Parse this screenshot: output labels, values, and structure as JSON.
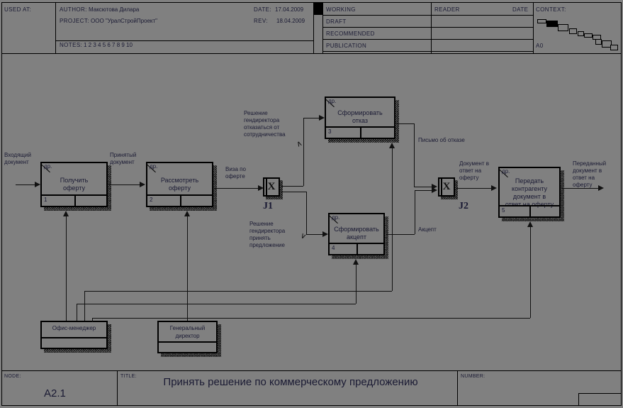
{
  "header": {
    "used_at_label": "USED AT:",
    "author_label": "AUTHOR:",
    "author_value": "Максютова Дилара",
    "project_label": "PROJECT:",
    "project_value": "ООО \"УралСтройПроект\"",
    "notes_label": "NOTES:",
    "notes_numbers": "1  2  3  4  5  6  7  8  9  10",
    "date_label": "DATE:",
    "date_value": "17.04.2009",
    "rev_label": "REV:",
    "rev_value": "18.04.2009",
    "status_rows": [
      "WORKING",
      "DRAFT",
      "RECOMMENDED",
      "PUBLICATION"
    ],
    "reader_label": "READER",
    "date_col_label": "DATE",
    "context_label": "CONTEXT:",
    "context_node": "A0"
  },
  "diagram": {
    "activities": [
      {
        "id": "a1",
        "corner": "др.",
        "title": "Получить\nоферту",
        "number": "1"
      },
      {
        "id": "a2",
        "corner": "др.",
        "title": "Рассмотреть\nоферту",
        "number": "2"
      },
      {
        "id": "a3",
        "corner": "др.",
        "title": "Сформировать\nотказ",
        "number": "3"
      },
      {
        "id": "a4",
        "corner": "др.",
        "title": "Сформировать\nакцепт",
        "number": "4"
      },
      {
        "id": "a5",
        "corner": "др.",
        "title": "Передать\nконтрагенту\nдокумент в\nответ на оферту",
        "number": "5"
      }
    ],
    "mechanisms": [
      {
        "id": "m1",
        "title": "Офис-менеджер"
      },
      {
        "id": "m2",
        "title": "Генеральный\nдиректор"
      }
    ],
    "junctions": [
      {
        "id": "j1",
        "glyph": "X",
        "label": "J1"
      },
      {
        "id": "j2",
        "glyph": "X",
        "label": "J2"
      }
    ],
    "flows": [
      {
        "id": "f_in",
        "text": "Входящий\nдокумент"
      },
      {
        "id": "f_accepted",
        "text": "Принятый\nдокумент"
      },
      {
        "id": "f_visa",
        "text": "Виза по\nоферте"
      },
      {
        "id": "f_refuse",
        "text": "Решение\nгендиректора\nотказаться от\nсотрудничества"
      },
      {
        "id": "f_accept",
        "text": "Решение\nгендиректора\nпринять\nпредложение"
      },
      {
        "id": "f_letter",
        "text": "Письмо об отказе"
      },
      {
        "id": "f_akcept",
        "text": "Акцепт"
      },
      {
        "id": "f_docreply",
        "text": "Документ в\nответ на\nоферту"
      },
      {
        "id": "f_out",
        "text": "Переданный\nдокумент в\nответ на\nоферту"
      }
    ]
  },
  "footer": {
    "node_label": "NODE:",
    "node_value": "A2.1",
    "title_label": "TITLE:",
    "title_value": "Принять решение  по коммерческому предложению",
    "number_label": "NUMBER:",
    "number_value": ""
  },
  "colors": {
    "background": "#808080",
    "ink": "#1a1a33",
    "line": "#111111"
  }
}
